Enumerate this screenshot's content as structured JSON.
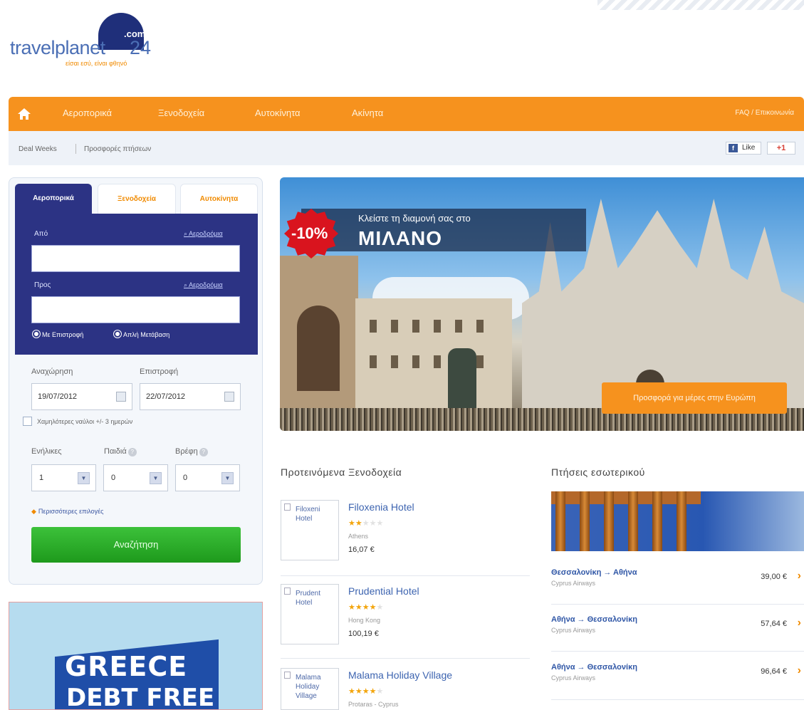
{
  "logo": {
    "com": ".com",
    "name": "travelplanet",
    "number": "24",
    "tagline": "είσαι εσύ, είναι φθηνό"
  },
  "nav": {
    "items": [
      "Αεροπορικά",
      "Ξενοδοχεία",
      "Αυτοκίνητα",
      "Ακίνητα"
    ],
    "right": "FAQ / Επικοινωνία"
  },
  "subbar": {
    "crumbs": [
      "Deal Weeks",
      "Προσφορές πτήσεων"
    ],
    "fb_like": "Like",
    "gplus": "+1"
  },
  "search": {
    "tabs": [
      "Αεροπορικά",
      "Ξενοδοχεία",
      "Αυτοκίνητα"
    ],
    "from_label": "Από",
    "to_label": "Προς",
    "airports_link": "Αεροδρόμια",
    "radio_return": "Με Επιστροφή",
    "radio_oneway": "Απλή Μετάβαση",
    "depart_label": "Αναχώρηση",
    "return_label": "Επιστροφή",
    "depart_date": "19/07/2012",
    "return_date": "22/07/2012",
    "flex_label": "Χαμηλότερες ναύλοι +/- 3 ημερών",
    "adults_label": "Ενήλικες",
    "children_label": "Παιδιά",
    "infants_label": "Βρέφη",
    "adults_value": "1",
    "children_value": "0",
    "infants_value": "0",
    "more_options": "Περισσότερες επιλογές",
    "submit": "Αναζήτηση"
  },
  "ad": {
    "line1": "GREECE",
    "line2": "DEBT FREE"
  },
  "hero": {
    "badge": "-10%",
    "small": "Κλείστε τη διαμονή σας στο",
    "big": "ΜΙΛΑΝΟ",
    "cta": "Προσφορά για μέρες στην Ευρώπη"
  },
  "hotels": {
    "title": "Προτεινόμενα Ξενοδοχεία",
    "items": [
      {
        "thumb": "Filoxeni Hotel",
        "name": "Filoxenia Hotel",
        "city": "Athens",
        "price": "16,07 €",
        "stars": 2
      },
      {
        "thumb": "Prudent Hotel",
        "name": "Prudential Hotel",
        "city": "Hong Kong",
        "price": "100,19 €",
        "stars": 4
      },
      {
        "thumb": "Malama Holiday Village",
        "name": "Malama Holiday Village",
        "city": "Protaras - Cyprus",
        "price": "",
        "stars": 4
      }
    ]
  },
  "flights": {
    "title": "Πτήσεις εσωτερικού",
    "items": [
      {
        "route": "Θεσσαλονίκη → Αθήνα",
        "airline": "Cyprus Airways",
        "price": "39,00 €"
      },
      {
        "route": "Αθήνα → Θεσσαλονίκη",
        "airline": "Cyprus Airways",
        "price": "57,64 €"
      },
      {
        "route": "Αθήνα → Θεσσαλονίκη",
        "airline": "Cyprus Airways",
        "price": "96,64 €"
      }
    ]
  },
  "colors": {
    "nav_orange": "#f6921e",
    "panel_navy": "#2c3384",
    "search_green": "#2aad28",
    "link_blue": "#3d64b0"
  }
}
